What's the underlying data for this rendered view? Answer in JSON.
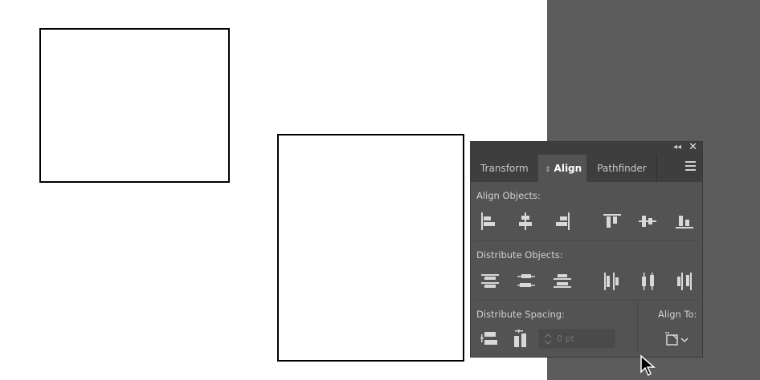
{
  "canvas": {
    "shapes": [
      {
        "name": "rectangle-1"
      },
      {
        "name": "rectangle-2"
      }
    ]
  },
  "panel": {
    "tabs": [
      {
        "label": "Transform",
        "active": false
      },
      {
        "label": "Align",
        "active": true
      },
      {
        "label": "Pathfinder",
        "active": false
      }
    ],
    "sections": {
      "align_objects": "Align Objects:",
      "distribute_objects": "Distribute Objects:",
      "distribute_spacing": "Distribute Spacing:",
      "align_to": "Align To:"
    },
    "spacing_value_placeholder": "0 pt",
    "icons": {
      "align_objects": [
        "align-left-edges-icon",
        "align-horizontal-centers-icon",
        "align-right-edges-icon",
        "align-top-edges-icon",
        "align-vertical-centers-icon",
        "align-bottom-edges-icon"
      ],
      "distribute_objects": [
        "distribute-top-edges-icon",
        "distribute-vertical-centers-icon",
        "distribute-bottom-edges-icon",
        "distribute-left-edges-icon",
        "distribute-horizontal-centers-icon",
        "distribute-right-edges-icon"
      ],
      "distribute_spacing": [
        "vertical-distribute-space-icon",
        "horizontal-distribute-space-icon"
      ],
      "align_to": "align-to-selection-icon"
    }
  },
  "colors": {
    "pasteboard": "#5c5c5c",
    "panel_bg": "#535353",
    "panel_header": "#3e3e3e",
    "icon": "#d8d8d8"
  }
}
